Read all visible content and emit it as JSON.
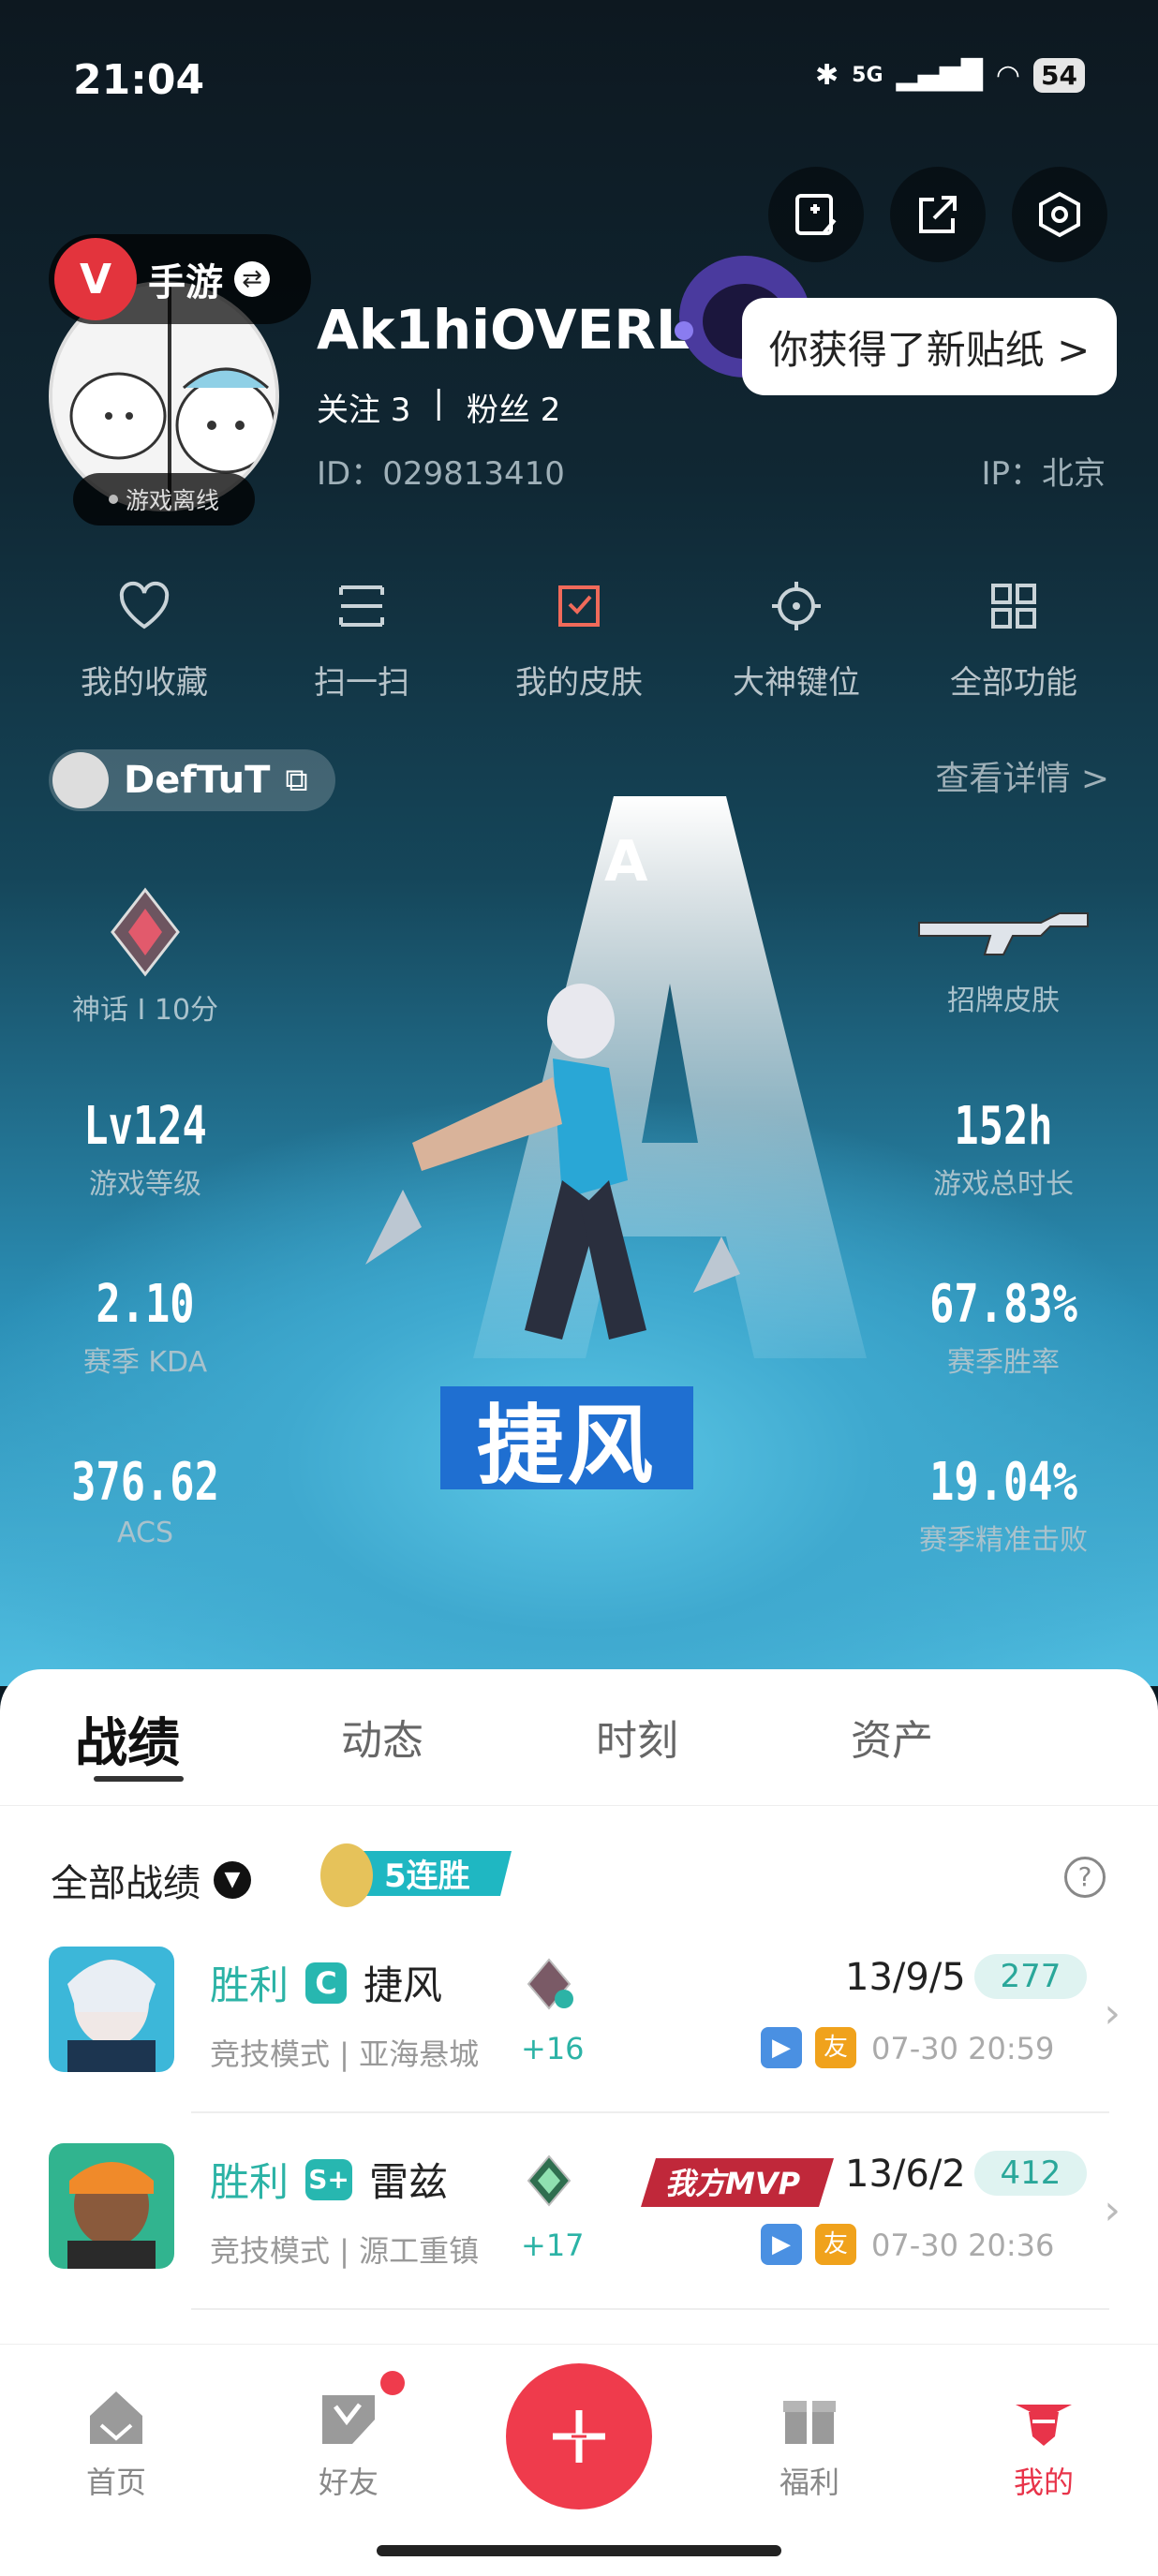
{
  "status_bar": {
    "time": "21:04",
    "network": "5G",
    "battery": "54"
  },
  "app": {
    "name": "手游"
  },
  "profile": {
    "username": "Ak1hiOVERLXRD",
    "status": "游戏离线",
    "following_label": "关注 3",
    "fans_label": "粉丝 2",
    "separator": "|",
    "id_text": "ID：029813410",
    "ip_text": "IP：北京",
    "sticker_notice": "你获得了新贴纸 >"
  },
  "functions": [
    {
      "label": "我的收藏",
      "icon": "heart-icon"
    },
    {
      "label": "扫一扫",
      "icon": "scan-icon"
    },
    {
      "label": "我的皮肤",
      "icon": "skin-icon"
    },
    {
      "label": "大神键位",
      "icon": "crosshair-icon"
    },
    {
      "label": "全部功能",
      "icon": "grid-icon"
    }
  ],
  "game_account": {
    "name": "DefTuT",
    "detail_link": "查看详情 >"
  },
  "stats": {
    "rank": {
      "label": "神话 I 10分"
    },
    "skin": {
      "label": "招牌皮肤"
    },
    "level": {
      "value": "Lv124",
      "label": "游戏等级"
    },
    "playtime": {
      "value": "152h",
      "label": "游戏总时长"
    },
    "kda": {
      "value": "2.10",
      "label": "赛季 KDA"
    },
    "winrate": {
      "value": "67.83%",
      "label": "赛季胜率"
    },
    "acs": {
      "value": "376.62",
      "label": "ACS"
    },
    "headshot": {
      "value": "19.04%",
      "label": "赛季精准击败"
    }
  },
  "featured_agent": {
    "name": "捷风",
    "letter": "A"
  },
  "tabs": [
    "战绩",
    "动态",
    "时刻",
    "资产"
  ],
  "record_filter": {
    "label": "全部战绩",
    "streak": "5连胜"
  },
  "matches": [
    {
      "result": "胜利",
      "badge": "C",
      "agent": "捷风",
      "mode": "竞技模式 | 亚海悬城",
      "points": "+16",
      "kda": "13/9/5",
      "acs": "277",
      "time": "07-30 20:59",
      "mvp": ""
    },
    {
      "result": "胜利",
      "badge": "S+",
      "agent": "雷兹",
      "mode": "竞技模式 | 源工重镇",
      "points": "+17",
      "kda": "13/6/2",
      "acs": "412",
      "time": "07-30 20:36",
      "mvp": "我方MVP"
    }
  ],
  "match_icons": {
    "video": "▶",
    "friend": "友"
  },
  "nav": [
    {
      "label": "首页"
    },
    {
      "label": "好友"
    },
    {
      "label": "福利"
    },
    {
      "label": "我的"
    }
  ],
  "colors": {
    "accent": "#ef3b4c",
    "win": "#2cb3a6"
  }
}
